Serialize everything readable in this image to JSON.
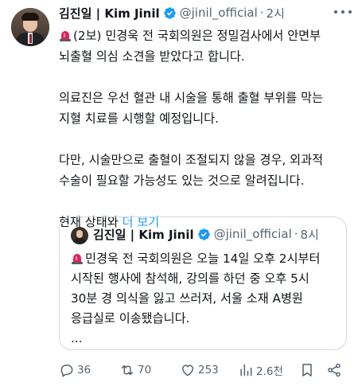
{
  "author": {
    "name": "김진일 | Kim Jinil",
    "handle": "@jinil_official",
    "separator": "·",
    "time": "2시"
  },
  "tweet": {
    "line1": "(2보) 민경욱 전 국회의원은 정밀검사에서 안면부",
    "line2": "뇌출혈 의심 소견을 받았다고 합니다.",
    "line3": "의료진은 우선 혈관 내 시술을 통해 출혈 부위를 막는",
    "line4": "지혈 치료를 시행할 예정입니다.",
    "line5": "다만, 시술만으로 출혈이 조절되지 않을 경우, 외과적",
    "line6": "수술이 필요할 가능성도 있는 것으로 알려집니다.",
    "line7_prefix": "현재 상태와 ",
    "show_more": "더 보기"
  },
  "quoted": {
    "name": "김진일 | Kim Jinil",
    "handle": "@jinil_official",
    "separator": "·",
    "time": "8시",
    "line1": "민경욱 전 국회의원은 오늘 14일 오후 2시부터",
    "line2": "시작된 행사에 참석해, 강의를 하던 중 오후 5시",
    "line3": "30분 경 의식을 잃고 쓰러져, 서울 소재 A병원",
    "line4": "응급실로 이송됐습니다.",
    "line5": "..."
  },
  "actions": {
    "replies": "36",
    "retweets": "70",
    "likes": "253",
    "views": "2.6천"
  },
  "icons": {
    "verified": "verified-badge-icon",
    "siren": "rotating-light-icon",
    "more": "more-dots-icon",
    "reply": "reply-icon",
    "retweet": "retweet-icon",
    "like": "heart-icon",
    "views": "views-chart-icon",
    "bookmark": "bookmark-icon",
    "share": "share-icon"
  },
  "colors": {
    "link": "#1d9bf0",
    "secondary": "#536471",
    "verified": "#1d9bf0",
    "border": "#cfd9de"
  }
}
